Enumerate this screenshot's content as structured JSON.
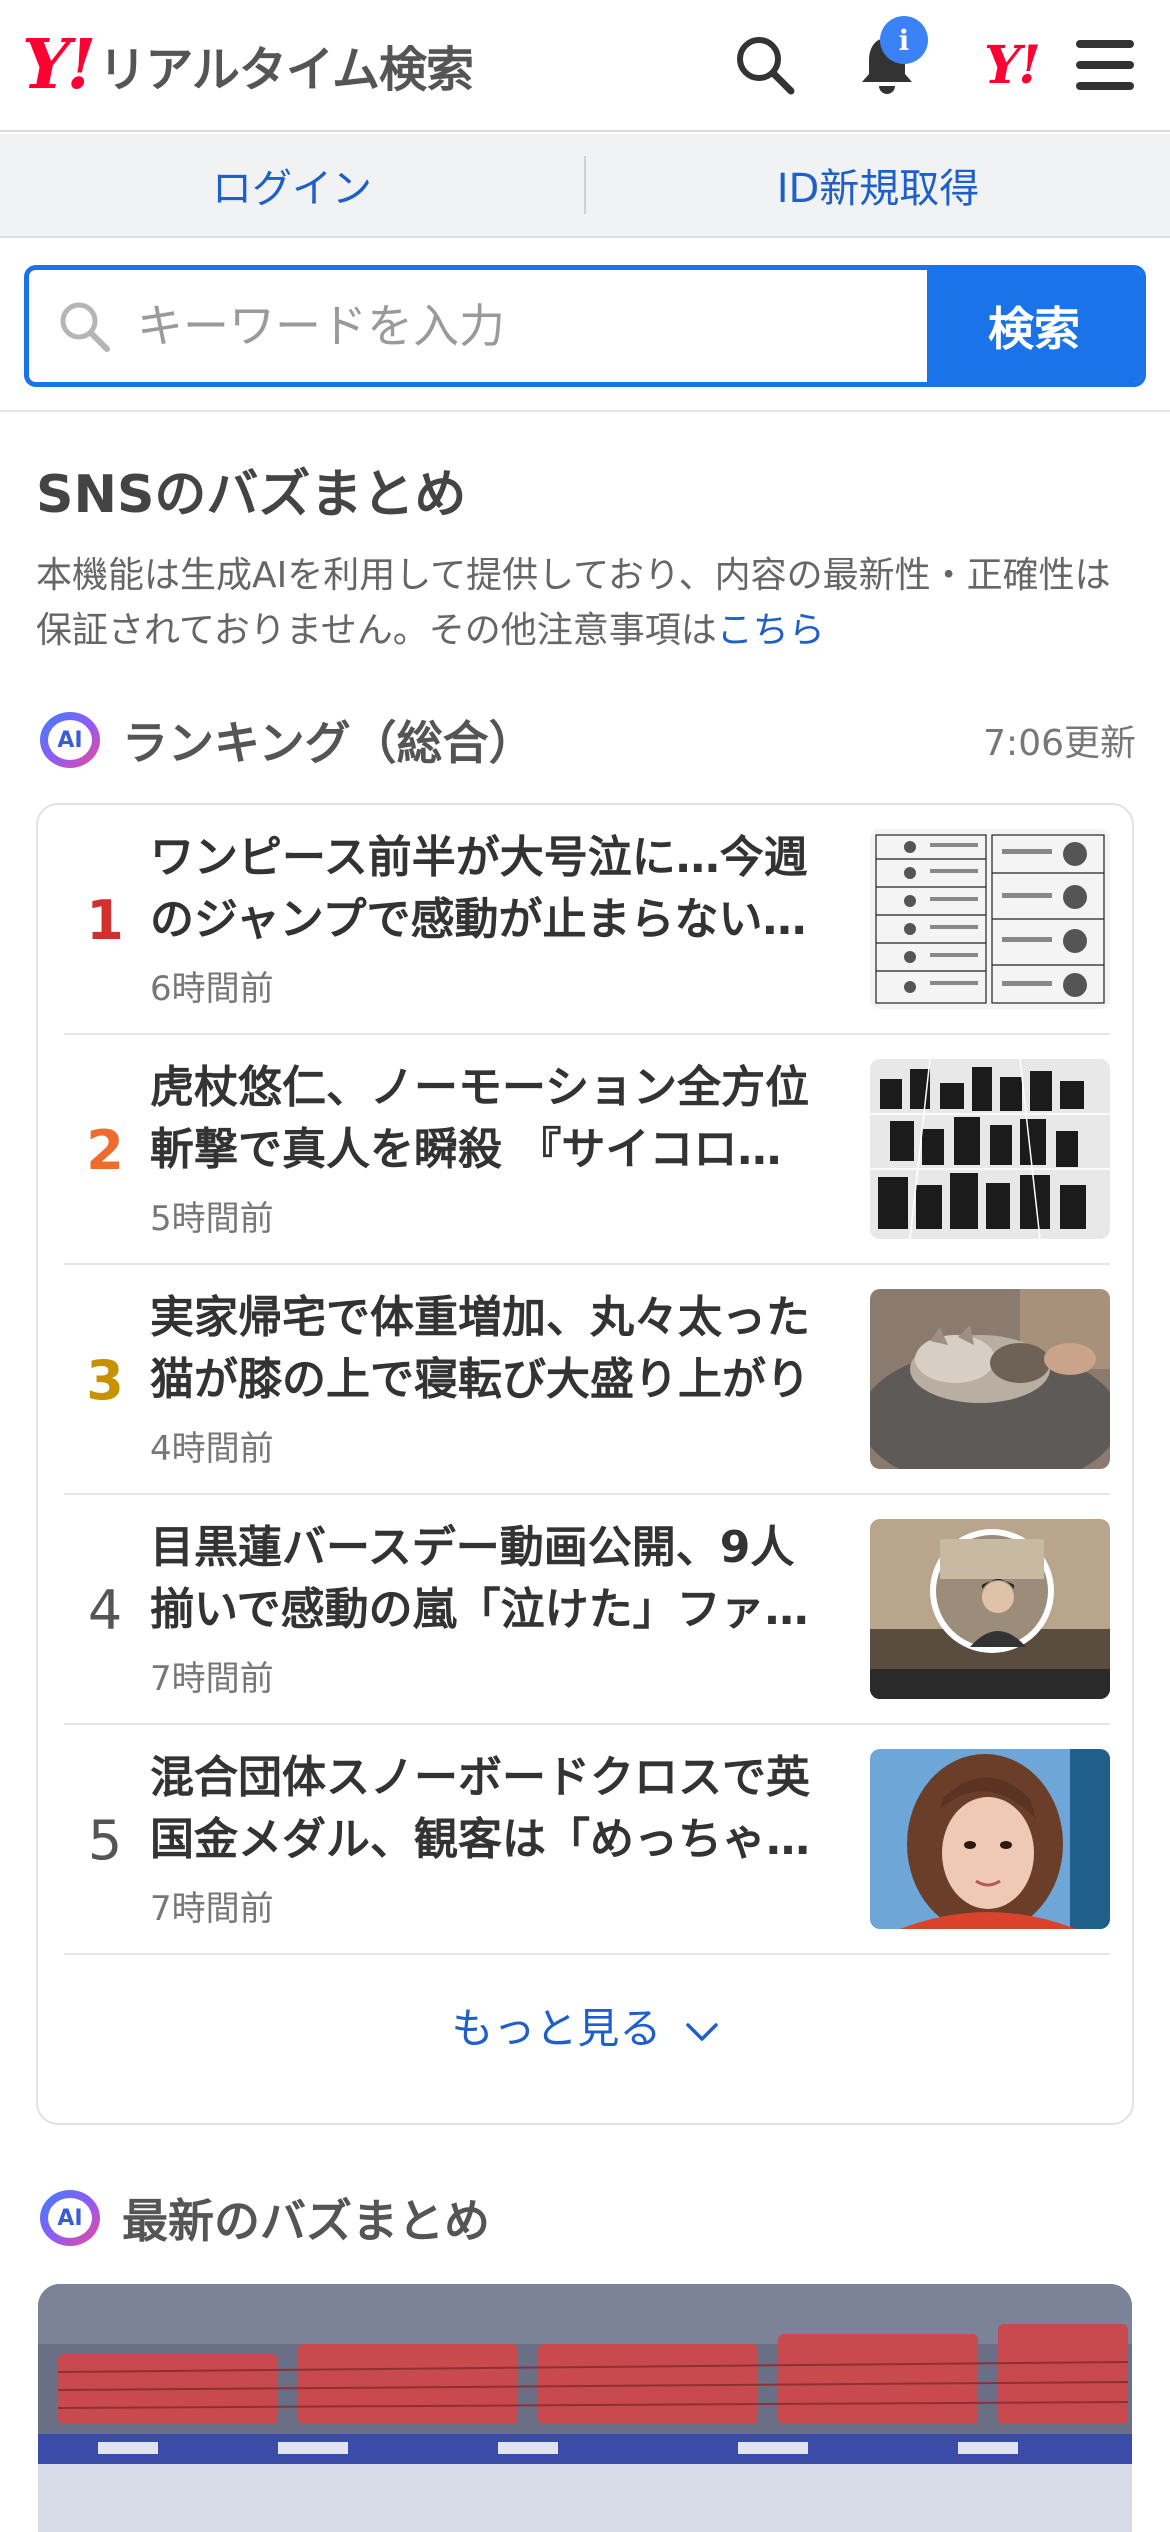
{
  "header": {
    "logo_mark": "Y!",
    "logo_text": "リアルタイム検索",
    "notification_badge": "i",
    "yahoo_mark": "Y!"
  },
  "auth": {
    "login": "ログイン",
    "signup": "ID新規取得"
  },
  "search": {
    "placeholder": "キーワードを入力",
    "button": "検索"
  },
  "buzz_section": {
    "title": "SNSのバズまとめ",
    "notice": "本機能は生成AIを利用して提供しており、内容の最新性・正確性は保証されておりません。その他注意事項は",
    "notice_link": "こちら"
  },
  "ranking": {
    "ai_label": "AI",
    "title": "ランキング（総合）",
    "updated": "7:06更新",
    "items": [
      {
        "rank": "1",
        "title": "ワンピース前半が大号泣に…今週のジャンプで感動が止まらない…",
        "time": "6時間前"
      },
      {
        "rank": "2",
        "title": "虎杖悠仁、ノーモーション全方位斬撃で真人を瞬殺 『サイコロ…",
        "time": "5時間前"
      },
      {
        "rank": "3",
        "title": "実家帰宅で体重増加、丸々太った猫が膝の上で寝転び大盛り上がり",
        "time": "4時間前"
      },
      {
        "rank": "4",
        "title": "目黒蓮バースデー動画公開、9人揃いで感動の嵐「泣けた」ファ…",
        "time": "7時間前"
      },
      {
        "rank": "5",
        "title": "混合団体スノーボードクロスで英国金メダル、観客は「めっちゃ…",
        "time": "7時間前"
      }
    ],
    "more": "もっと見る"
  },
  "latest": {
    "ai_label": "AI",
    "title": "最新のバズまとめ"
  },
  "colors": {
    "brand_red": "#ff0033",
    "link_blue": "#1e5fc9",
    "search_blue": "#1a73e8"
  }
}
